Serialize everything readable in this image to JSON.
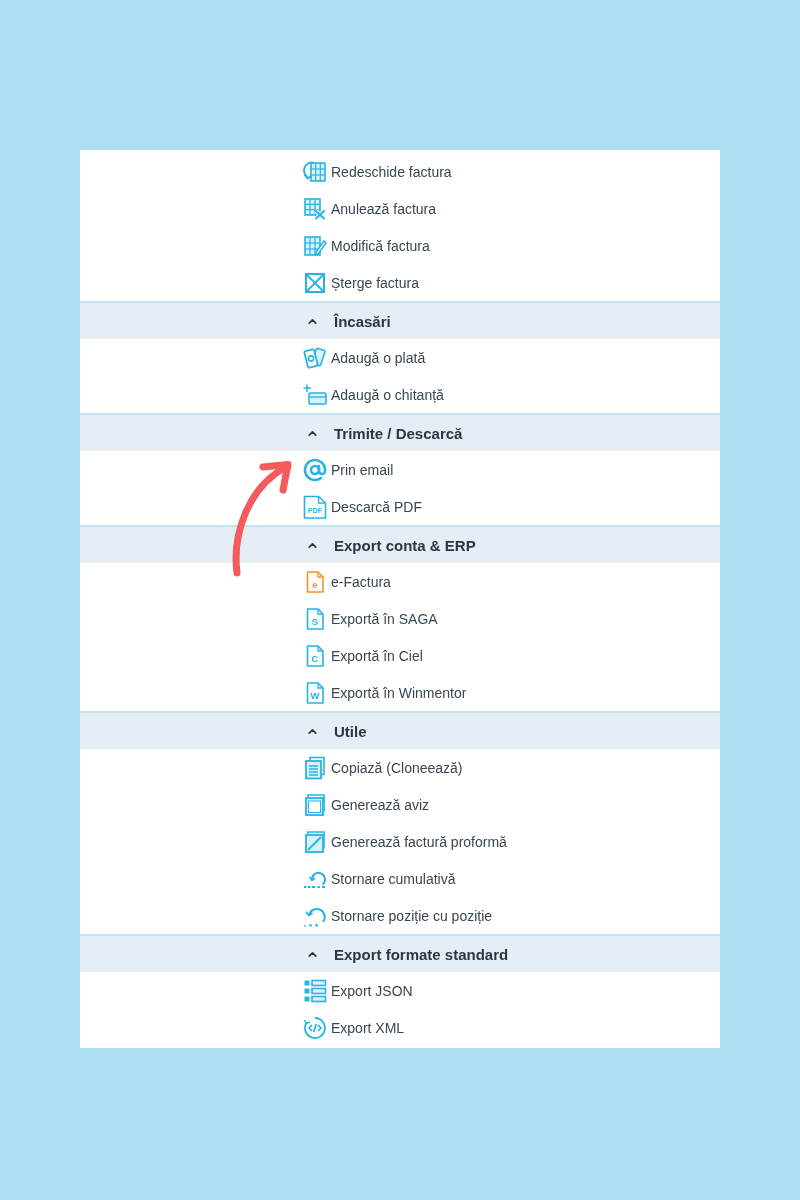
{
  "panel": {
    "items": [
      {
        "label": "Redeschide factura"
      },
      {
        "label": "Anulează factura"
      },
      {
        "label": "Modifică factura"
      },
      {
        "label": "Șterge factura"
      }
    ],
    "sections": [
      {
        "title": "Încasări",
        "expanded": true,
        "items": [
          {
            "label": "Adaugă o plată"
          },
          {
            "label": "Adaugă o chitanță"
          }
        ]
      },
      {
        "title": "Trimite / Descarcă",
        "expanded": true,
        "items": [
          {
            "label": "Prin email"
          },
          {
            "label": "Descarcă PDF",
            "icon_text": "PDF"
          }
        ]
      },
      {
        "title": "Export conta & ERP",
        "expanded": true,
        "items": [
          {
            "label": "e-Factura",
            "icon_text": "e"
          },
          {
            "label": "Exportă în SAGA",
            "icon_text": "S"
          },
          {
            "label": "Exportă în Ciel",
            "icon_text": "C"
          },
          {
            "label": "Exportă în Winmentor",
            "icon_text": "W"
          }
        ]
      },
      {
        "title": "Utile",
        "expanded": true,
        "items": [
          {
            "label": "Copiază (Cloneează)"
          },
          {
            "label": "Generează aviz"
          },
          {
            "label": "Generează factură proformă"
          },
          {
            "label": "Stornare cumulativă"
          },
          {
            "label": "Stornare poziție cu poziție"
          }
        ]
      },
      {
        "title": "Export formate standard",
        "expanded": true,
        "items": [
          {
            "label": "Export JSON"
          },
          {
            "label": "Export XML"
          }
        ]
      }
    ]
  }
}
